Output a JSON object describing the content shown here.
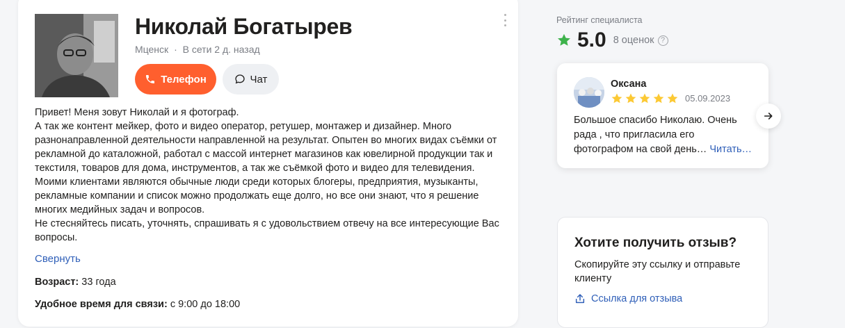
{
  "profile": {
    "name": "Николай Богатырев",
    "city": "Мценск",
    "separator": "·",
    "online": "В сети 2 д. назад",
    "phone_label": "Телефон",
    "chat_label": "Чат"
  },
  "about": {
    "lines": [
      "Привет! Меня зовут Николай и я фотограф.",
      "А так же контент мейкер, фото и видео оператор, ретушер, монтажер и дизайнер. Много разнонаправленной деятельности направленной на результат. Опытен во многих видах съёмки от рекламной до каталожной, работал с массой интернет магазинов как ювелирной продукции так и текстиля, товаров для дома, инструментов, а так же съёмкой фото и видео для телевидения. Моими клиентами являются обычные люди среди которых блогеры, предприятия, музыканты, рекламные компании и список можно продолжать еще долго, но все они знают, что я решение многих медийных задач и вопросов.",
      "Не стесняйтесь писать, уточнять, спрашивать я с удовольствием отвечу на все интересующие Вас вопросы."
    ],
    "collapse_label": "Свернуть"
  },
  "details": {
    "age_label": "Возраст:",
    "age_value": "33 года",
    "time_label": "Удобное время для связи:",
    "time_value": "с 9:00 до 18:00"
  },
  "rating": {
    "label": "Рейтинг специалиста",
    "value": "5.0",
    "count": "8 оценок",
    "help": "?",
    "star_color": "#3db24b"
  },
  "review": {
    "author": "Оксана",
    "stars": 5,
    "date": "05.09.2023",
    "text": "Большое спасибо Николаю. Очень рада , что пригласила его фотографом на свой день…",
    "read_more": "Читать…",
    "star_color": "#fcc934"
  },
  "request": {
    "title": "Хотите получить отзыв?",
    "description": "Скопируйте эту ссылку и отправьте клиенту",
    "link_label": "Ссылка для отзыва"
  },
  "colors": {
    "accent": "#ff5f2e",
    "link": "#2f5fb8"
  }
}
